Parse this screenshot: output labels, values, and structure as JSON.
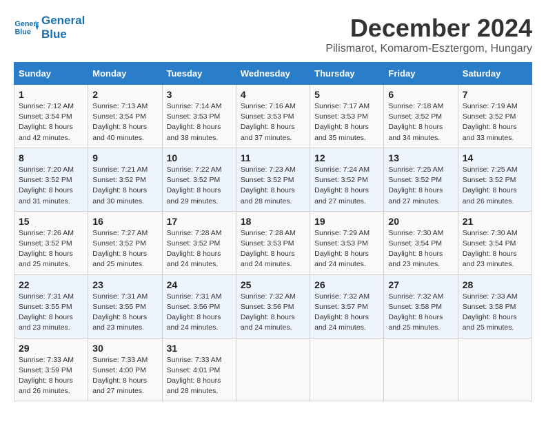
{
  "logo": {
    "line1": "General",
    "line2": "Blue"
  },
  "title": "December 2024",
  "subtitle": "Pilismarot, Komarom-Esztergom, Hungary",
  "weekdays": [
    "Sunday",
    "Monday",
    "Tuesday",
    "Wednesday",
    "Thursday",
    "Friday",
    "Saturday"
  ],
  "weeks": [
    [
      {
        "day": "1",
        "sunrise": "7:12 AM",
        "sunset": "3:54 PM",
        "daylight": "8 hours and 42 minutes."
      },
      {
        "day": "2",
        "sunrise": "7:13 AM",
        "sunset": "3:54 PM",
        "daylight": "8 hours and 40 minutes."
      },
      {
        "day": "3",
        "sunrise": "7:14 AM",
        "sunset": "3:53 PM",
        "daylight": "8 hours and 38 minutes."
      },
      {
        "day": "4",
        "sunrise": "7:16 AM",
        "sunset": "3:53 PM",
        "daylight": "8 hours and 37 minutes."
      },
      {
        "day": "5",
        "sunrise": "7:17 AM",
        "sunset": "3:53 PM",
        "daylight": "8 hours and 35 minutes."
      },
      {
        "day": "6",
        "sunrise": "7:18 AM",
        "sunset": "3:52 PM",
        "daylight": "8 hours and 34 minutes."
      },
      {
        "day": "7",
        "sunrise": "7:19 AM",
        "sunset": "3:52 PM",
        "daylight": "8 hours and 33 minutes."
      }
    ],
    [
      {
        "day": "8",
        "sunrise": "7:20 AM",
        "sunset": "3:52 PM",
        "daylight": "8 hours and 31 minutes."
      },
      {
        "day": "9",
        "sunrise": "7:21 AM",
        "sunset": "3:52 PM",
        "daylight": "8 hours and 30 minutes."
      },
      {
        "day": "10",
        "sunrise": "7:22 AM",
        "sunset": "3:52 PM",
        "daylight": "8 hours and 29 minutes."
      },
      {
        "day": "11",
        "sunrise": "7:23 AM",
        "sunset": "3:52 PM",
        "daylight": "8 hours and 28 minutes."
      },
      {
        "day": "12",
        "sunrise": "7:24 AM",
        "sunset": "3:52 PM",
        "daylight": "8 hours and 27 minutes."
      },
      {
        "day": "13",
        "sunrise": "7:25 AM",
        "sunset": "3:52 PM",
        "daylight": "8 hours and 27 minutes."
      },
      {
        "day": "14",
        "sunrise": "7:25 AM",
        "sunset": "3:52 PM",
        "daylight": "8 hours and 26 minutes."
      }
    ],
    [
      {
        "day": "15",
        "sunrise": "7:26 AM",
        "sunset": "3:52 PM",
        "daylight": "8 hours and 25 minutes."
      },
      {
        "day": "16",
        "sunrise": "7:27 AM",
        "sunset": "3:52 PM",
        "daylight": "8 hours and 25 minutes."
      },
      {
        "day": "17",
        "sunrise": "7:28 AM",
        "sunset": "3:52 PM",
        "daylight": "8 hours and 24 minutes."
      },
      {
        "day": "18",
        "sunrise": "7:28 AM",
        "sunset": "3:53 PM",
        "daylight": "8 hours and 24 minutes."
      },
      {
        "day": "19",
        "sunrise": "7:29 AM",
        "sunset": "3:53 PM",
        "daylight": "8 hours and 24 minutes."
      },
      {
        "day": "20",
        "sunrise": "7:30 AM",
        "sunset": "3:54 PM",
        "daylight": "8 hours and 23 minutes."
      },
      {
        "day": "21",
        "sunrise": "7:30 AM",
        "sunset": "3:54 PM",
        "daylight": "8 hours and 23 minutes."
      }
    ],
    [
      {
        "day": "22",
        "sunrise": "7:31 AM",
        "sunset": "3:55 PM",
        "daylight": "8 hours and 23 minutes."
      },
      {
        "day": "23",
        "sunrise": "7:31 AM",
        "sunset": "3:55 PM",
        "daylight": "8 hours and 23 minutes."
      },
      {
        "day": "24",
        "sunrise": "7:31 AM",
        "sunset": "3:56 PM",
        "daylight": "8 hours and 24 minutes."
      },
      {
        "day": "25",
        "sunrise": "7:32 AM",
        "sunset": "3:56 PM",
        "daylight": "8 hours and 24 minutes."
      },
      {
        "day": "26",
        "sunrise": "7:32 AM",
        "sunset": "3:57 PM",
        "daylight": "8 hours and 24 minutes."
      },
      {
        "day": "27",
        "sunrise": "7:32 AM",
        "sunset": "3:58 PM",
        "daylight": "8 hours and 25 minutes."
      },
      {
        "day": "28",
        "sunrise": "7:33 AM",
        "sunset": "3:58 PM",
        "daylight": "8 hours and 25 minutes."
      }
    ],
    [
      {
        "day": "29",
        "sunrise": "7:33 AM",
        "sunset": "3:59 PM",
        "daylight": "8 hours and 26 minutes."
      },
      {
        "day": "30",
        "sunrise": "7:33 AM",
        "sunset": "4:00 PM",
        "daylight": "8 hours and 27 minutes."
      },
      {
        "day": "31",
        "sunrise": "7:33 AM",
        "sunset": "4:01 PM",
        "daylight": "8 hours and 28 minutes."
      },
      null,
      null,
      null,
      null
    ]
  ],
  "labels": {
    "sunrise": "Sunrise:",
    "sunset": "Sunset:",
    "daylight": "Daylight:"
  }
}
